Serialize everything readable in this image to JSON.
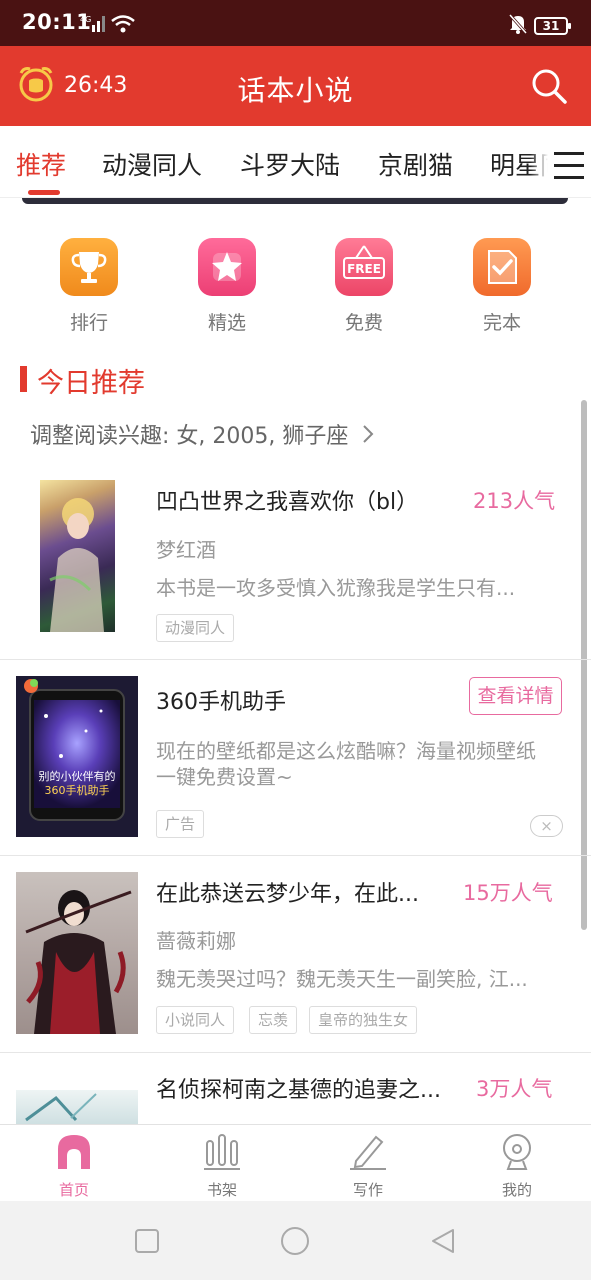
{
  "status_bar": {
    "time": "20:11",
    "network": "4G",
    "battery": "31"
  },
  "header": {
    "timer": "26:43",
    "title": "话本小说"
  },
  "tabs": [
    {
      "label": "推荐",
      "active": true
    },
    {
      "label": "动漫同人",
      "active": false
    },
    {
      "label": "斗罗大陆",
      "active": false
    },
    {
      "label": "京剧猫",
      "active": false
    },
    {
      "label": "明星同人",
      "active": false
    }
  ],
  "quick_links": [
    {
      "label": "排行",
      "icon": "trophy-icon",
      "color": "#f59a2f"
    },
    {
      "label": "精选",
      "icon": "star-icon",
      "color": "#f04f86"
    },
    {
      "label": "免费",
      "icon": "free-sign-icon",
      "color": "#f0557a",
      "badge": "FREE"
    },
    {
      "label": "完本",
      "icon": "check-book-icon",
      "color": "#f5793a"
    }
  ],
  "section": {
    "title": "今日推荐",
    "interest": "调整阅读兴趣: 女, 2005, 狮子座"
  },
  "books": [
    {
      "title": "凹凸世界之我喜欢你（bl）",
      "popularity": "213人气",
      "author": "梦红酒",
      "description": "本书是一攻多受慎入犹豫我是学生只有...",
      "tags": [
        "动漫同人"
      ]
    },
    {
      "title": "在此恭送云梦少年，在此...",
      "popularity": "15万人气",
      "author": "蔷薇莉娜",
      "description": "魏无羡哭过吗？魏无羡天生一副笑脸, 江...",
      "tags": [
        "小说同人",
        "忘羡",
        "皇帝的独生女"
      ]
    },
    {
      "title": "名侦探柯南之基德的追妻之...",
      "popularity": "3万人气",
      "author": "",
      "description": "",
      "tags": []
    }
  ],
  "ad": {
    "title": "360手机助手",
    "button": "查看详情",
    "description_line1": "现在的壁纸都是这么炫酷嘛？海量视频壁纸",
    "description_line2": "一键免费设置~",
    "label": "广告",
    "close": "×",
    "cover_caption_line1": "别的小伙伴有的",
    "cover_caption_line2": "360手机助手"
  },
  "bottom_nav": [
    {
      "label": "首页",
      "icon": "home-icon",
      "active": true
    },
    {
      "label": "书架",
      "icon": "bookshelf-icon",
      "active": false
    },
    {
      "label": "写作",
      "icon": "pencil-icon",
      "active": false
    },
    {
      "label": "我的",
      "icon": "profile-icon",
      "active": false
    }
  ],
  "colors": {
    "brand_red": "#e23a2e",
    "accent_pink": "#e86a9f",
    "status_bar": "#4a1212"
  }
}
